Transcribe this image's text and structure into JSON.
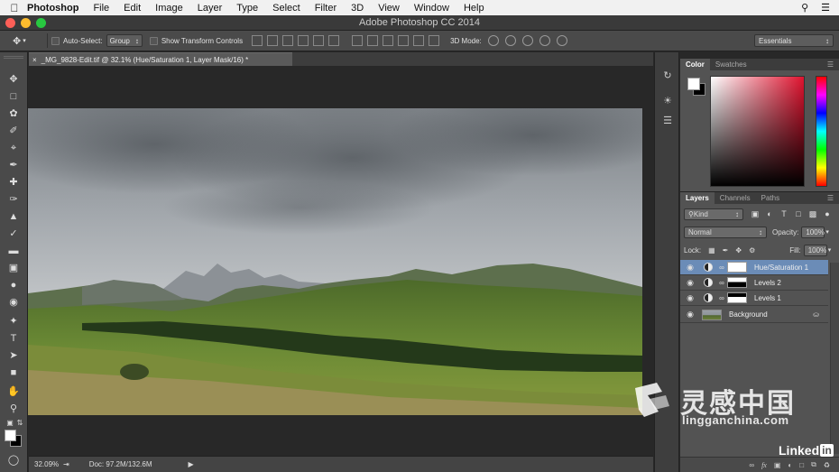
{
  "menubar": {
    "app_name": "Photoshop",
    "items": [
      "File",
      "Edit",
      "Image",
      "Layer",
      "Type",
      "Select",
      "Filter",
      "3D",
      "View",
      "Window",
      "Help"
    ]
  },
  "window": {
    "title": "Adobe Photoshop CC 2014"
  },
  "options": {
    "auto_select_label": "Auto-Select:",
    "auto_select_value": "Group",
    "show_transform_label": "Show Transform Controls",
    "mode_3d_label": "3D Mode:",
    "workspace": "Essentials"
  },
  "document": {
    "tab_title": "_MG_9828-Edit.tif @ 32.1% (Hue/Saturation 1, Layer Mask/16) *",
    "zoom": "32.09%",
    "doc_size": "Doc: 97.2M/132.6M"
  },
  "color_panel": {
    "tabs": [
      "Color",
      "Swatches"
    ],
    "active_tab": "Color"
  },
  "layers_panel": {
    "tabs": [
      "Layers",
      "Channels",
      "Paths"
    ],
    "filter_kind": "Kind",
    "blend_mode": "Normal",
    "opacity_label": "Opacity:",
    "opacity": "100%",
    "lock_label": "Lock:",
    "fill_label": "Fill:",
    "fill": "100%",
    "layers": [
      {
        "name": "Hue/Saturation 1",
        "selected": true
      },
      {
        "name": "Levels 2",
        "selected": false
      },
      {
        "name": "Levels 1",
        "selected": false
      },
      {
        "name": "Background",
        "selected": false
      }
    ]
  },
  "watermark": {
    "cn": "灵感中国",
    "en": "lingganchina.com",
    "brand": "Linked",
    "brand_in": "in"
  },
  "colors": {
    "selected_layer": "#6b8cb7",
    "panel_bg": "#535353",
    "ui_dark": "#282828"
  }
}
